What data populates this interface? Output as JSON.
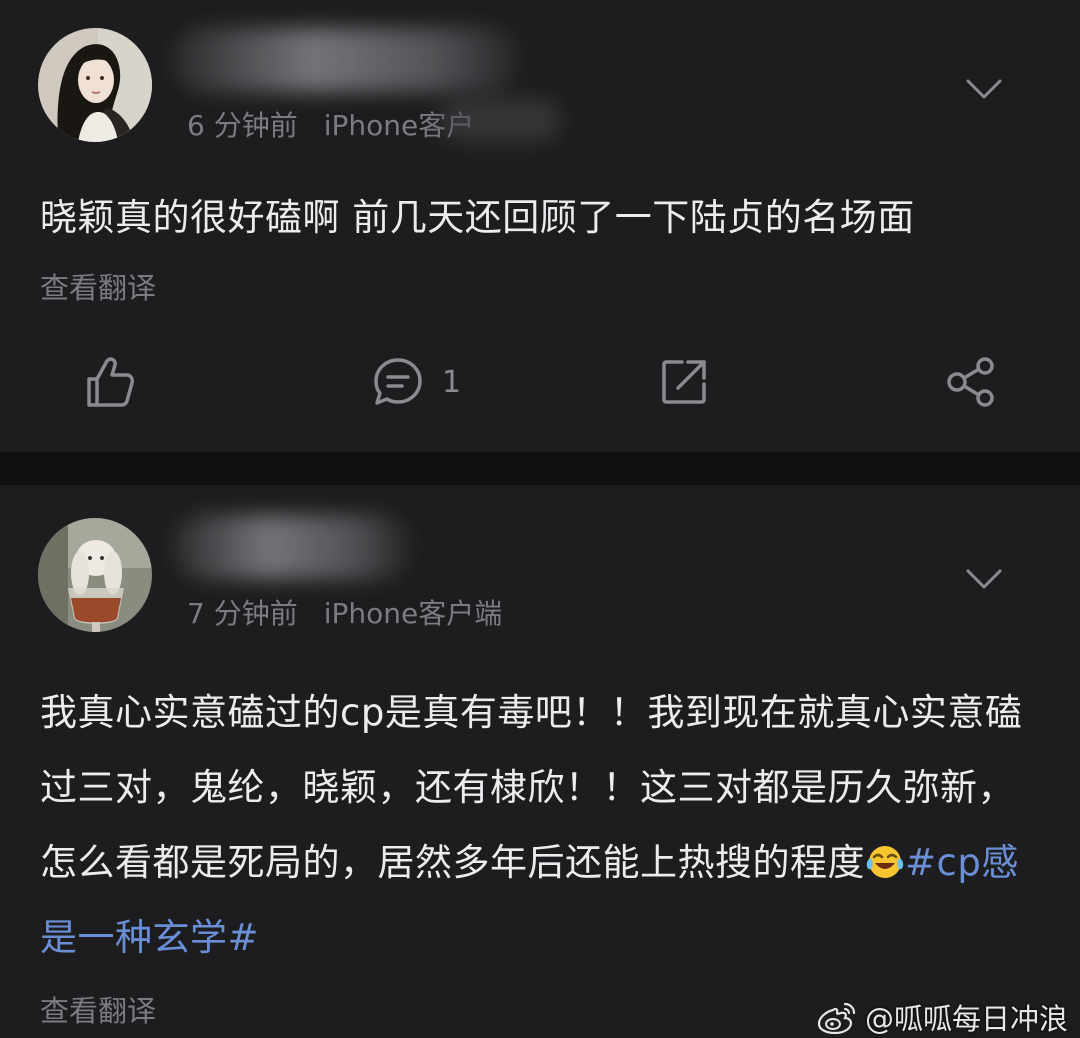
{
  "posts": [
    {
      "time": "6 分钟前",
      "client": "iPhone客户端",
      "client_visible": "iPhone客户",
      "text": "晓颖真的很好磕啊 前几天还回顾了一下陆贞的名场面",
      "translate_label": "查看翻译",
      "actions": {
        "like_icon": "thumbs-up-icon",
        "comment_icon": "comment-icon",
        "comment_count": "1",
        "repost_icon": "repost-icon",
        "share_icon": "share-icon"
      }
    },
    {
      "time": "7 分钟前",
      "client": "iPhone客户端",
      "text_before_emoji": "我真心实意磕过的cp是真有毒吧！！我到现在就真心实意磕过三对，鬼纶，晓颖，还有棣欣！！这三对都是历久弥新，怎么看都是死局的，居然多年后还能上热搜的程度",
      "emoji": "laughing-crying-emoji",
      "topic": "#cp感是一种玄学#",
      "translate_label": "查看翻译"
    }
  ],
  "watermark": {
    "icon": "weibo-logo-icon",
    "text": "@呱呱每日冲浪"
  },
  "colors": {
    "background": "#1d1d1f",
    "separator": "#101012",
    "text": "#ececef",
    "secondary_text": "#7b7b80",
    "topic_link": "#6a8fd6"
  }
}
